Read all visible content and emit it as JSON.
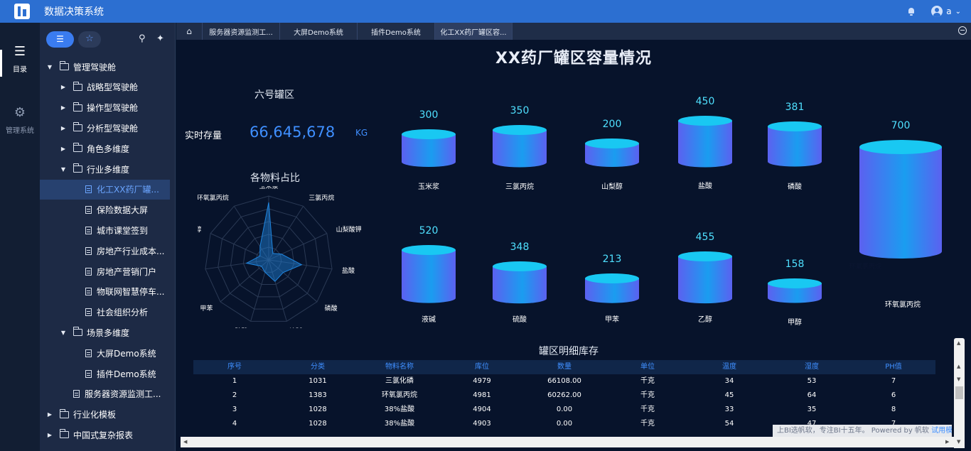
{
  "app": {
    "title": "数据决策系统",
    "user": "a"
  },
  "rail": {
    "catalog_label": "目录",
    "admin_label": "管理系统"
  },
  "tree": {
    "nodes": [
      {
        "label": "管理驾驶舱",
        "level": 0,
        "type": "folder",
        "state": "open"
      },
      {
        "label": "战略型驾驶舱",
        "level": 1,
        "type": "folder",
        "state": "closed"
      },
      {
        "label": "操作型驾驶舱",
        "level": 1,
        "type": "folder",
        "state": "closed"
      },
      {
        "label": "分析型驾驶舱",
        "level": 1,
        "type": "folder",
        "state": "closed"
      },
      {
        "label": "角色多维度",
        "level": 1,
        "type": "folder",
        "state": "closed"
      },
      {
        "label": "行业多维度",
        "level": 1,
        "type": "folder",
        "state": "open"
      },
      {
        "label": "化工XX药厂罐...",
        "level": 2,
        "type": "doc",
        "selected": true
      },
      {
        "label": "保险数据大屏",
        "level": 2,
        "type": "doc"
      },
      {
        "label": "城市课堂签到",
        "level": 2,
        "type": "doc"
      },
      {
        "label": "房地产行业成本...",
        "level": 2,
        "type": "doc"
      },
      {
        "label": "房地产营销门户",
        "level": 2,
        "type": "doc"
      },
      {
        "label": "物联网智慧停车...",
        "level": 2,
        "type": "doc"
      },
      {
        "label": "社会组织分析",
        "level": 2,
        "type": "doc"
      },
      {
        "label": "场景多维度",
        "level": 1,
        "type": "folder",
        "state": "open"
      },
      {
        "label": "大屏Demo系统",
        "level": 2,
        "type": "doc"
      },
      {
        "label": "插件Demo系统",
        "level": 2,
        "type": "doc"
      },
      {
        "label": "服务器资源监测工...",
        "level": 1,
        "type": "doc"
      },
      {
        "label": "行业化模板",
        "level": 0,
        "type": "folder",
        "state": "closed"
      },
      {
        "label": "中国式复杂报表",
        "level": 0,
        "type": "folder",
        "state": "closed"
      }
    ]
  },
  "tabs": [
    {
      "label": "服务器资源监测工...",
      "active": false
    },
    {
      "label": "大屏Demo系统",
      "active": false
    },
    {
      "label": "插件Demo系统",
      "active": false
    },
    {
      "label": "化工XX药厂罐区容...",
      "active": true
    }
  ],
  "dashboard": {
    "title": "XX药厂罐区容量情况",
    "zone": "六号罐区",
    "stock_label": "实时存量",
    "stock_value": "66,645,678",
    "stock_unit": "KG",
    "ratio_title": "各物料占比",
    "detail_title": "罐区明细库存",
    "watermark": "上BI选帆软，专注BI十五年。 Powered by 帆软 ",
    "watermark_trial": "试用模式",
    "tank_overlap_label": "环氧氯丙烷"
  },
  "chart_data": [
    {
      "type": "radar",
      "title": "各物料占比",
      "categories": [
        "玉米浆",
        "三氯丙烷",
        "山梨酸钾",
        "盐酸",
        "磷酸",
        "液碱",
        "硫酸",
        "甲苯",
        "乙醇",
        "甲醇",
        "环氧氯丙烷"
      ],
      "values": [
        0.9,
        0.12,
        0.22,
        0.52,
        0.3,
        0.35,
        0.2,
        0.15,
        0.35,
        0.15,
        0.25
      ],
      "max": 1,
      "color": "#1f86e0"
    },
    {
      "type": "bar",
      "style": "cylinder",
      "categories": [
        "玉米浆",
        "三氯丙烷",
        "山梨醇",
        "盐酸",
        "磷酸",
        "液碱",
        "硫酸",
        "甲苯",
        "乙醇",
        "甲醇",
        "环氧氯丙烷"
      ],
      "values": [
        300,
        350,
        200,
        450,
        381,
        520,
        348,
        213,
        455,
        158,
        700
      ],
      "colors": {
        "top": "#19c8f2",
        "side_left": "#5b61f0",
        "side_mid": "#1a9df0"
      }
    }
  ],
  "table": {
    "columns": [
      "序号",
      "分类",
      "物料名称",
      "库位",
      "数量",
      "单位",
      "温度",
      "湿度",
      "PH值"
    ],
    "rows": [
      [
        "1",
        "1031",
        "三氯化磷",
        "4979",
        "66108.00",
        "千克",
        "34",
        "53",
        "7"
      ],
      [
        "2",
        "1383",
        "环氧氯丙烷",
        "4981",
        "60262.00",
        "千克",
        "45",
        "64",
        "6"
      ],
      [
        "3",
        "1028",
        "38%盐酸",
        "4904",
        "0.00",
        "千克",
        "33",
        "35",
        "8"
      ],
      [
        "4",
        "1028",
        "38%盐酸",
        "4903",
        "0.00",
        "千克",
        "54",
        "47",
        "7"
      ]
    ]
  }
}
